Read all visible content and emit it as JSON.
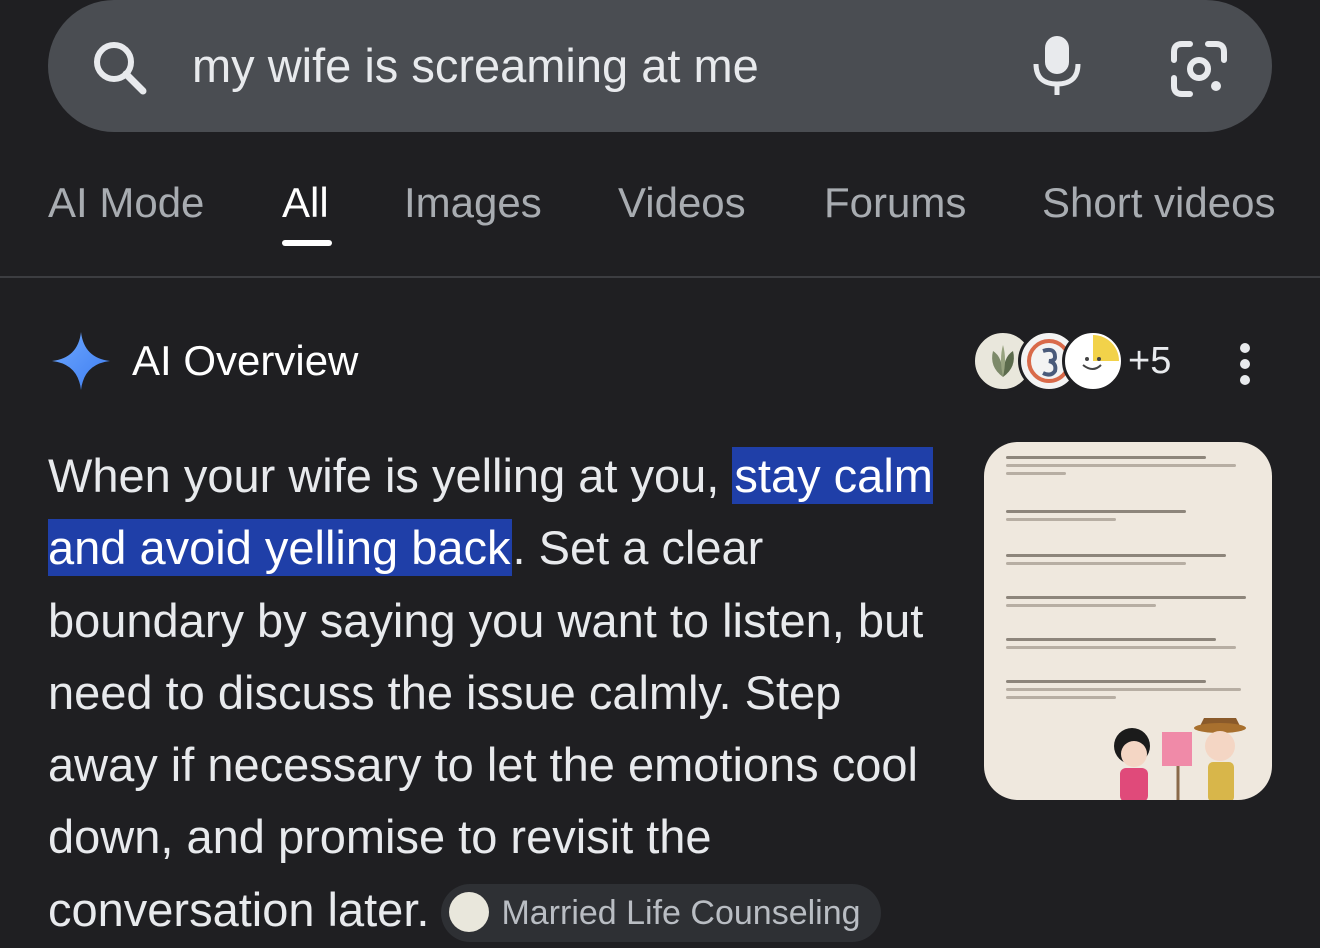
{
  "search": {
    "query": "my wife is screaming at me"
  },
  "tabs": [
    {
      "label": "AI Mode"
    },
    {
      "label": "All"
    },
    {
      "label": "Images"
    },
    {
      "label": "Videos"
    },
    {
      "label": "Forums"
    },
    {
      "label": "Short videos"
    }
  ],
  "overview": {
    "title": "AI Overview",
    "source_count": "+5",
    "text_before": "When your wife is yelling at you, ",
    "text_highlight": "stay calm and avoid yelling back",
    "text_after": ". Set a clear boundary by saying you want to listen, but need to discuss the issue calmly. Step away if necessary to let the emotions cool down, and promise to revisit the conversation later.",
    "citation": "Married Life Counseling"
  },
  "colors": {
    "background": "#1f1f22",
    "search_bar": "#4a4d52",
    "highlight": "#1f3fa8",
    "sparkle": "#4a8cf7"
  }
}
